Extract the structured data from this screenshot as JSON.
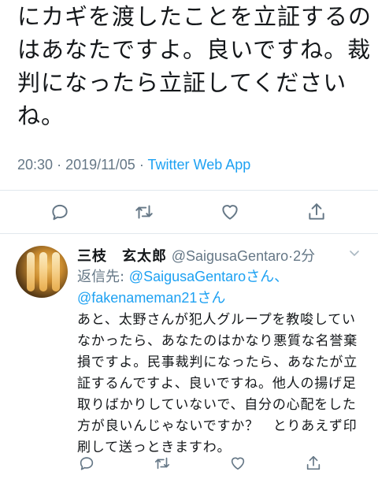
{
  "tweet": {
    "text_lines": [
      "にカギを渡したことを立証するの",
      "はあなたですよ。良いですね。裁",
      "判になったら立証してください",
      "ね。"
    ],
    "time": "20:30",
    "date": "2019/11/05",
    "source": "Twitter Web App"
  },
  "reply": {
    "display_name": "三枝　玄太郎",
    "handle": "@SaigusaGentaro",
    "age": "2分",
    "replying_prefix": "返信先: ",
    "mention1": "@SaigusaGentaro",
    "mention1_suffix": "さん、",
    "mention2": "@fakenameman21",
    "mention2_suffix": "さん",
    "text_lines": [
      "あと、太野さんが犯人グループを教唆してい",
      "なかったら、あなたのはかなり悪質な名誉棄",
      "損ですよ。民事裁判になったら、あなたが立",
      "証するんですよ、良いですね。他人の揚げ足",
      "取りばかりしていないで、自分の心配をした",
      "方が良いんじゃないですか？　とりあえず印",
      "刷して送っときますわ。"
    ]
  },
  "icons": {
    "reply": "reply-icon",
    "retweet": "retweet-icon",
    "like": "heart-icon",
    "share": "share-icon",
    "more": "chevron-down-icon"
  },
  "colors": {
    "link": "#1da1f2",
    "muted": "#657786",
    "divider": "#e1e8ed"
  }
}
